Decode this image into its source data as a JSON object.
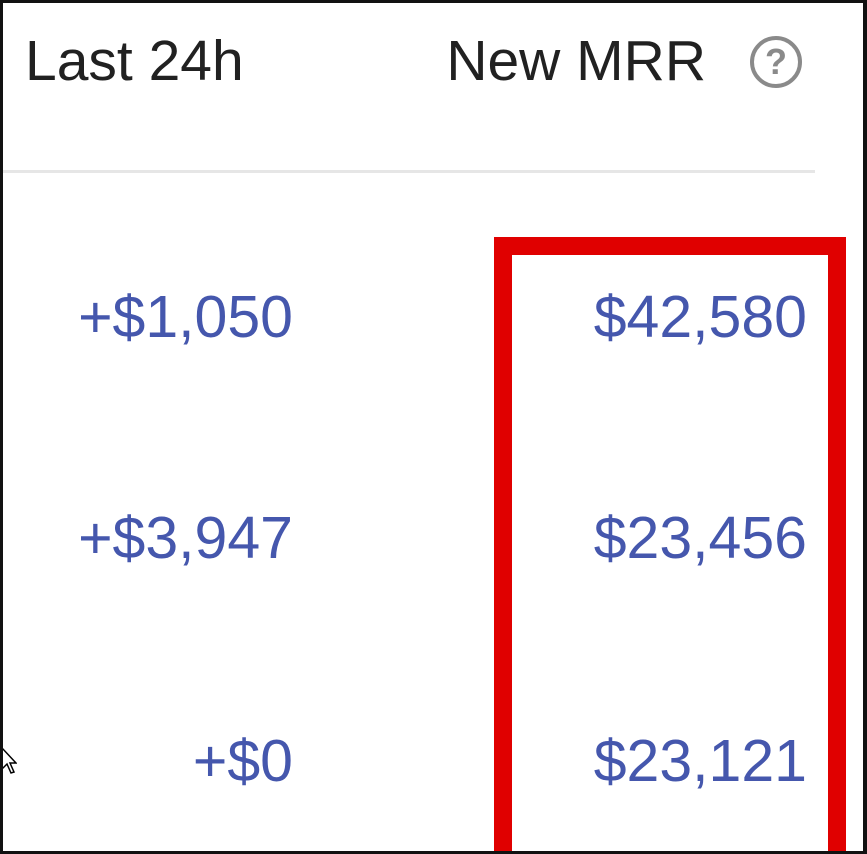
{
  "table": {
    "headers": {
      "last_24h": "Last 24h",
      "new_mrr": "New MRR"
    },
    "help_icon": {
      "glyph": "?",
      "icon": "question-circle-icon"
    },
    "rows": [
      {
        "change": "+$1,050",
        "mrr": "$42,580"
      },
      {
        "change": "+$3,947",
        "mrr": "$23,456"
      },
      {
        "change": "+$0",
        "mrr": "$23,121"
      }
    ]
  },
  "highlight": {
    "target": "new-mrr-column",
    "color": "#e00000"
  },
  "colors": {
    "header_text": "#212121",
    "value_text": "#4557ad",
    "divider": "#e6e6e6",
    "icon": "#8a8a8a"
  }
}
